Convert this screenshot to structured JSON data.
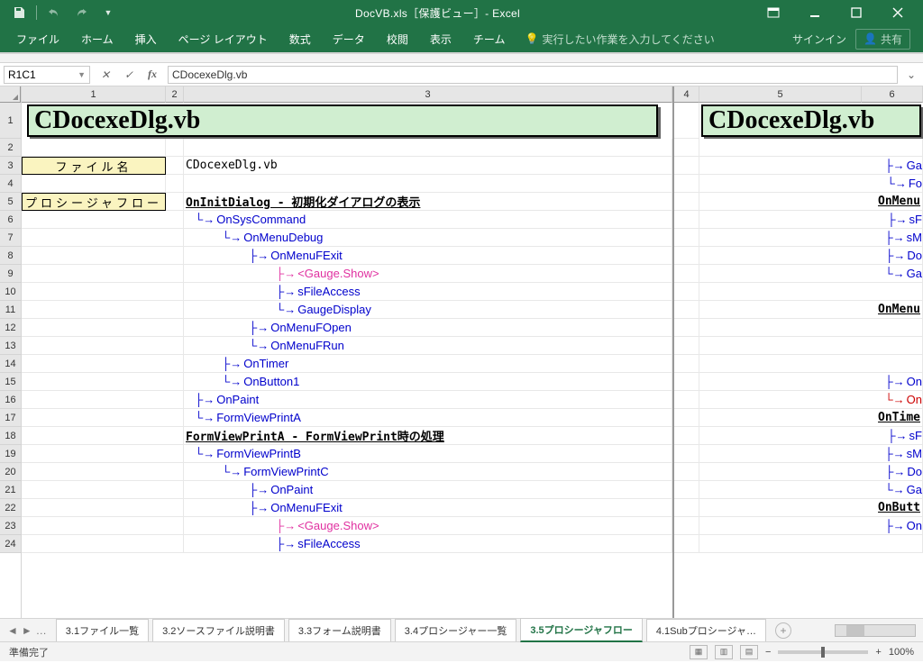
{
  "app": {
    "title": "DocVB.xls［保護ビュー］- Excel",
    "signin": "サインイン",
    "share": "共有"
  },
  "ribbon": {
    "tabs": [
      "ファイル",
      "ホーム",
      "挿入",
      "ページ レイアウト",
      "数式",
      "データ",
      "校閲",
      "表示",
      "チーム"
    ],
    "tellme": "実行したい作業を入力してください"
  },
  "fxbar": {
    "namebox": "R1C1",
    "formula": "CDocexeDlg.vb"
  },
  "columns": {
    "c1_width": 160,
    "c2_width": 20,
    "c3_width": 542,
    "c4_width": 30,
    "c5_width": 180,
    "c6_width": 60
  },
  "col_labels": [
    "1",
    "2",
    "3",
    "4",
    "5",
    "6"
  ],
  "row_labels": [
    "1",
    "2",
    "3",
    "4",
    "5",
    "6",
    "7",
    "8",
    "9",
    "10",
    "11",
    "12",
    "13",
    "14",
    "15",
    "16",
    "17",
    "18",
    "19",
    "20",
    "21",
    "22",
    "23",
    "24"
  ],
  "headings": {
    "title_left": "CDocexeDlg.vb",
    "title_right": "CDocexeDlg.vb",
    "label_file": "ファイル名",
    "label_flow": "プロシージャフロー",
    "filename": "CDocexeDlg.vb"
  },
  "flow_left": {
    "r5": "OnInitDialog - 初期化ダイアログの表示",
    "r6": "OnSysCommand",
    "r7": "OnMenuDebug",
    "r8": "OnMenuFExit",
    "r9": "<Gauge.Show>",
    "r10": "sFileAccess",
    "r11": "GaugeDisplay",
    "r12": "OnMenuFOpen",
    "r13": "OnMenuFRun",
    "r14": "OnTimer",
    "r15": "OnButton1",
    "r16": "OnPaint",
    "r17": "FormViewPrintA",
    "r18": "FormViewPrintA - FormViewPrint時の処理",
    "r19": "FormViewPrintB",
    "r20": "FormViewPrintC",
    "r21": "OnPaint",
    "r22": "OnMenuFExit",
    "r23": "<Gauge.Show>",
    "r24": "sFileAccess"
  },
  "flow_right": {
    "r3a": "Ga",
    "r3b": "Fo",
    "r5": "OnMenu",
    "r6": "sF",
    "r7": "sM",
    "r8": "Do",
    "r9": "Ga",
    "r11": "OnMenu",
    "r15": "On",
    "r16": "On",
    "r17": "OnTime",
    "r18": "sF",
    "r19": "sM",
    "r20": "Do",
    "r21": "Ga",
    "r22": "OnButt",
    "r23": "On"
  },
  "sheets": {
    "tabs": [
      "3.1ファイル一覧",
      "3.2ソースファイル説明書",
      "3.3フォーム説明書",
      "3.4プロシージャー一覧",
      "3.5プロシージャフロー",
      "4.1Subプロシージャ…"
    ],
    "active_index": 4
  },
  "status": {
    "left": "準備完了",
    "zoom": "100%"
  }
}
